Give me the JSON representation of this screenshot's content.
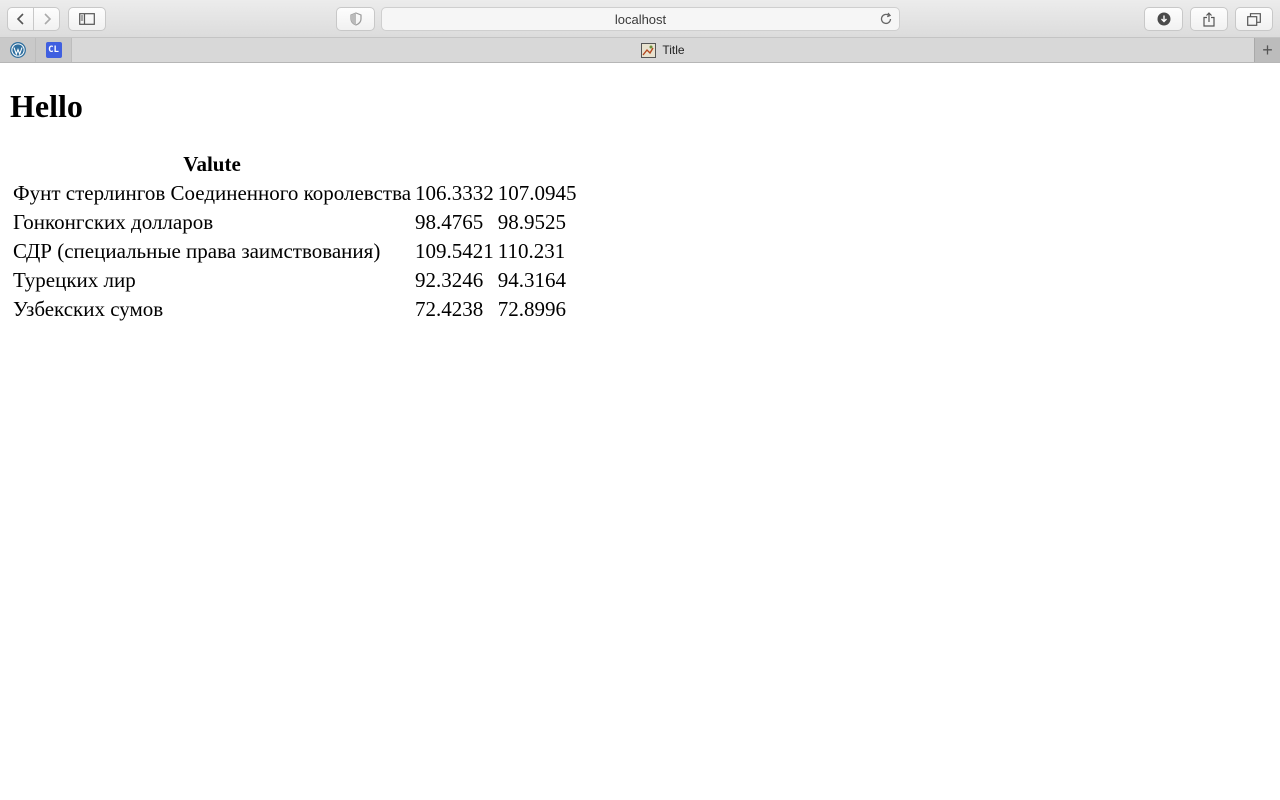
{
  "browser": {
    "address": "localhost",
    "pinned_tabs": [
      {
        "icon": "wordpress-icon"
      },
      {
        "icon": "cl-icon",
        "label": "CL"
      }
    ],
    "active_tab": {
      "title": "Title"
    },
    "new_tab_label": "+"
  },
  "page": {
    "heading": "Hello",
    "table": {
      "header": "Valute",
      "rows": [
        {
          "name": "Фунт стерлингов Соединенного королевства",
          "v1": "106.3332",
          "v2": "107.0945"
        },
        {
          "name": "Гонконгских долларов",
          "v1": "98.4765",
          "v2": "98.9525"
        },
        {
          "name": "СДР (специальные права заимствования)",
          "v1": "109.5421",
          "v2": "110.231"
        },
        {
          "name": "Турецких лир",
          "v1": "92.3246",
          "v2": "94.3164"
        },
        {
          "name": "Узбекских сумов",
          "v1": "72.4238",
          "v2": "72.8996"
        }
      ]
    }
  }
}
